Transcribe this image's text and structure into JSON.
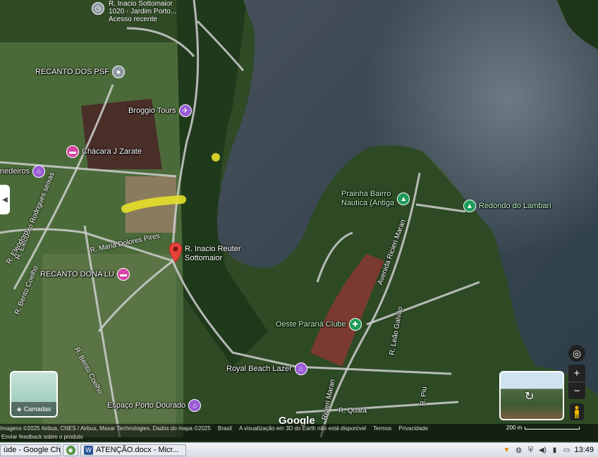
{
  "map": {
    "recent": {
      "line1": "R. Inacio Sottomaior",
      "line2": "1020 - Jardim Porto...",
      "line3": "Acesso recente"
    },
    "places": {
      "recanto_psf": "RECANTO DOS PSF",
      "broggio": "Broggio Tours",
      "chacara": "Chácara J Zarate",
      "medeiros": "nedeiros",
      "prainha": "Prainha Bairro\nNautica (Antiga",
      "redondo": "Redondo do Lambari",
      "recanto_lu": "RECANTO DONA LU",
      "oeste": "Oeste Paraná Clube",
      "royal": "Royal Beach Lazer",
      "espaco": "Espaço Porto Dourado"
    },
    "streets": {
      "eleodoro1": "R. Eleodoro Rodrigues seixas",
      "eleodoro2": "R. Eleodoro",
      "bento1": "R. Bento Coelho",
      "bento2": "R. Bento Coelho",
      "maria": "R. Maria Dolores Pires",
      "avenida": "Avenida Ricieri Maran",
      "ricieri2": "Ricieri Maran",
      "leao": "R. Leão Galvão",
      "piu": "R. Piu",
      "quata": "R. Quata"
    },
    "selected": {
      "label": "R. Inacio Reuter\nSottomaior"
    },
    "layers_label": "Camadas",
    "controls": {
      "zoom_in": "+",
      "zoom_out": "−"
    },
    "google": "Google",
    "attribution": [
      "Imagens ©2025 Airbus, CNES / Airbus, Maxar Technologies, Dados do mapa ©2025",
      "Brasil",
      "A visualização em 3D do Earth não está disponível",
      "Termos",
      "Privacidade"
    ],
    "scale": "200 m",
    "feedback": "Enviar feedback sobre o produto"
  },
  "taskbar": {
    "tab1": "úde - Google Ch...",
    "tab2": "ATENÇÃO.docx - Micr...",
    "clock": "13:49"
  },
  "colors": {
    "pink": "#d446a6",
    "green": "#1f9c5a",
    "red": "#e5423b"
  }
}
